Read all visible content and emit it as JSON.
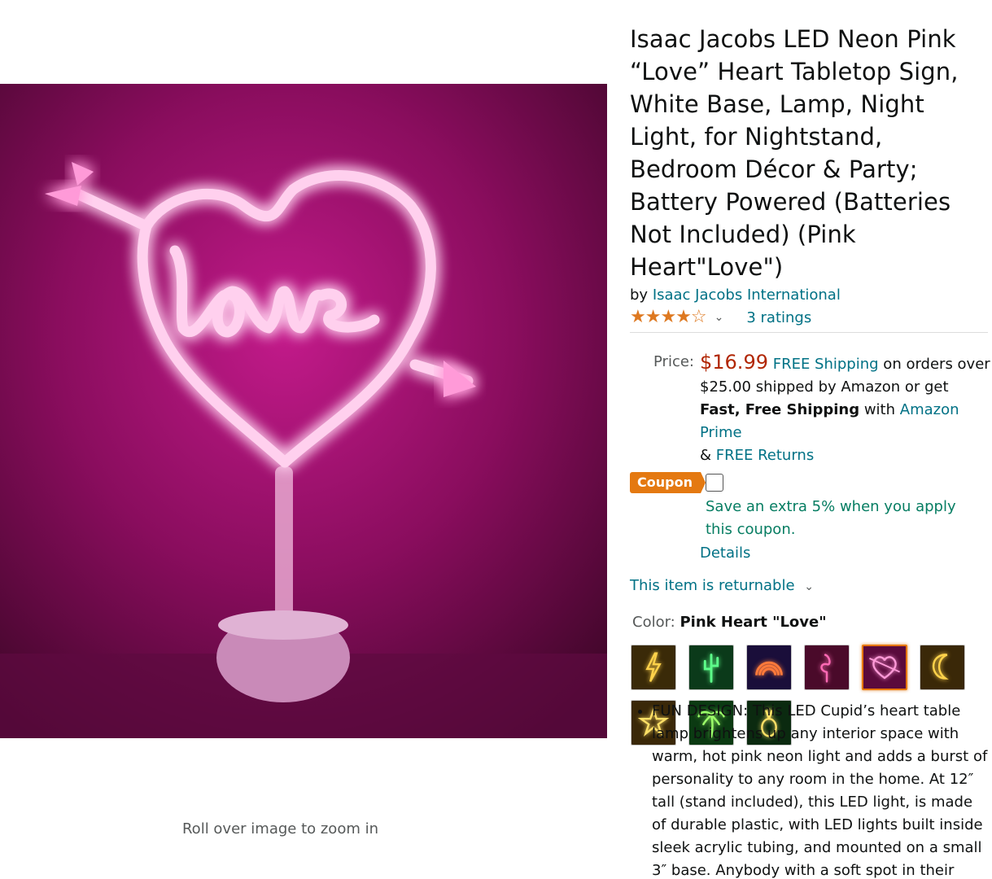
{
  "product": {
    "title": "Isaac Jacobs LED Neon Pink “Love” Heart Tabletop Sign, White Base, Lamp, Night Light, for Nightstand, Bedroom Décor & Party; Battery Powered (Batteries Not Included) (Pink Heart\"Love\")",
    "by_prefix": "by",
    "brand": "Isaac Jacobs International",
    "rating_stars": 4.5,
    "stars_glyph": "★★★★☆",
    "ratings_text": "3 ratings"
  },
  "image": {
    "zoom_hint": "Roll over image to zoom in",
    "sign_text": "love"
  },
  "price": {
    "label": "Price:",
    "value": "$16.99",
    "free_shipping_link": "FREE Shipping",
    "shipping_text_1": " on orders over $25.00 shipped by Amazon or get ",
    "fast_free": "Fast, Free Shipping",
    "with_text": " with ",
    "prime_link": "Amazon Prime",
    "amp_text": "& ",
    "returns_link": "FREE Returns"
  },
  "coupon": {
    "badge": "Coupon",
    "text": "Save an extra 5% when you apply this coupon.",
    "details_link": "Details"
  },
  "returnable": {
    "text": "This item is returnable",
    "chevron": "⌄"
  },
  "color": {
    "label": "Color:",
    "selected": "Pink Heart \"Love\""
  },
  "swatches": [
    {
      "name": "Lightning",
      "bg": "#3a2a08",
      "glow": "#ffd24a"
    },
    {
      "name": "Cactus",
      "bg": "#0b3a1a",
      "glow": "#5dff8a"
    },
    {
      "name": "Rainbow",
      "bg": "#1a0e3a",
      "glow": "#ff7a3a"
    },
    {
      "name": "Flamingo",
      "bg": "#4a0a2a",
      "glow": "#ff6ab5"
    },
    {
      "name": "Pink Heart \"Love\"",
      "bg": "#5a0a3c",
      "glow": "#ff9ad8"
    },
    {
      "name": "Moon",
      "bg": "#3a2808",
      "glow": "#ffd24a"
    },
    {
      "name": "Star",
      "bg": "#3a2808",
      "glow": "#ffe066"
    },
    {
      "name": "Palm Tree",
      "bg": "#0b3a12",
      "glow": "#9dff6a"
    },
    {
      "name": "Pineapple",
      "bg": "#0b2a10",
      "glow": "#ffe066"
    }
  ],
  "selected_swatch_index": 4,
  "bullets": [
    "FUN DESIGN: This LED Cupid’s heart table lamp brightens up any interior space with warm, hot pink neon light and adds a burst of personality to any room in the home. At 12″ tall (stand included), this LED light, is made of durable plastic, with LED lights built inside sleek acrylic tubing, and mounted on a small 3″ base. Anybody with a soft spot in their"
  ],
  "colors": {
    "link": "#007185",
    "price": "#B12704",
    "coupon_badge": "#E47911",
    "coupon_text": "#067D62",
    "star": "#de7921"
  }
}
